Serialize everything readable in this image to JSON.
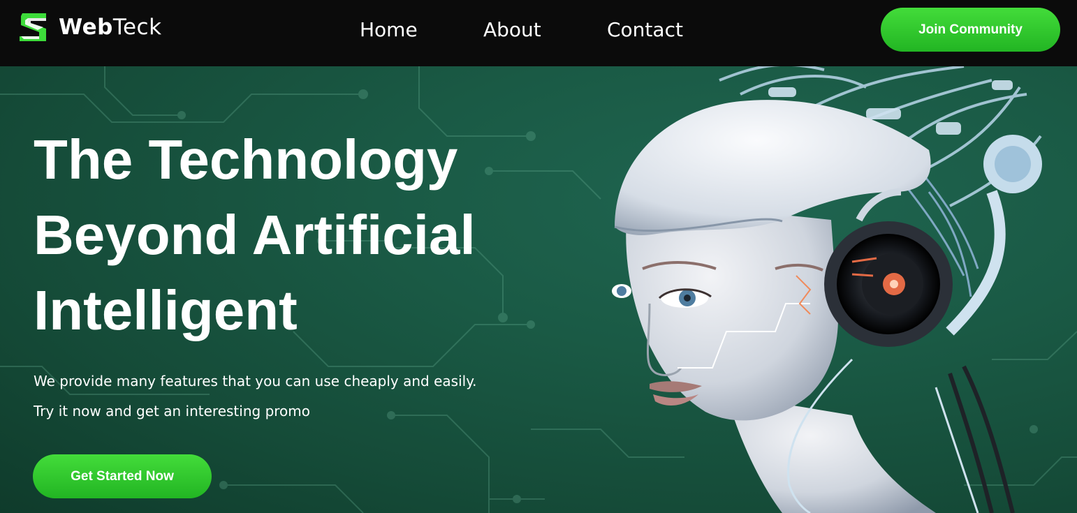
{
  "brand": {
    "name_bold": "Web",
    "name_regular": "Teck",
    "logo_icon": "s-shaped-logo-icon",
    "accent": "#3ddc3a"
  },
  "nav": {
    "links": [
      {
        "label": "Home"
      },
      {
        "label": "About"
      },
      {
        "label": "Contact"
      }
    ],
    "join_label": "Join Community"
  },
  "hero": {
    "title_lines": [
      "The Technology",
      "Beyond Artificial",
      "Intelligent"
    ],
    "description": "We provide many features that you can use cheaply and easily. Try it now and get an interesting promo",
    "cta_label": "Get Started Now",
    "background": "#1a5a45",
    "image": "android-woman-with-headphones-illustration"
  }
}
